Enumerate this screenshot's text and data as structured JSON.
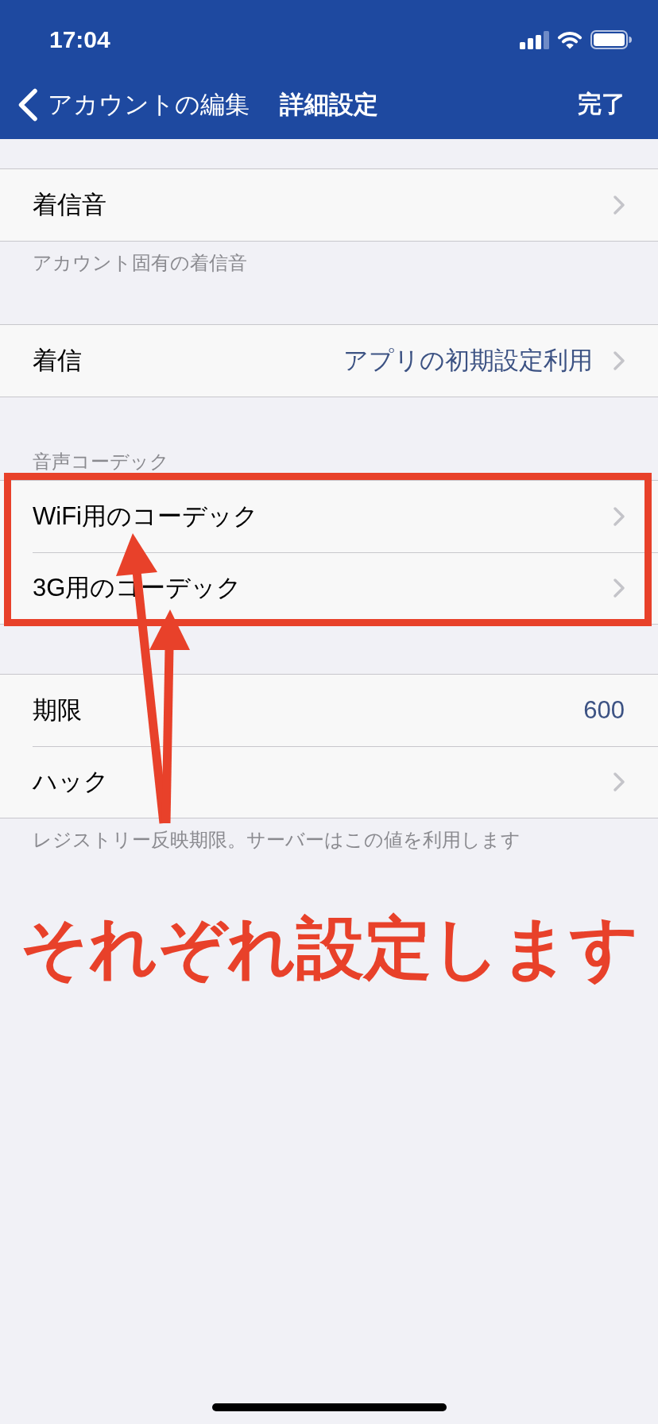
{
  "status_bar": {
    "time": "17:04"
  },
  "nav_bar": {
    "back_label": "アカウントの編集",
    "title": "詳細設定",
    "action": "完了"
  },
  "sections": [
    {
      "rows": [
        {
          "label": "着信音",
          "disclosure": true
        }
      ],
      "footer": "アカウント固有の着信音"
    },
    {
      "rows": [
        {
          "label": "着信",
          "value": "アプリの初期設定利用",
          "disclosure": true
        }
      ]
    },
    {
      "header": "音声コーデック",
      "rows": [
        {
          "label": "WiFi用のコーデック",
          "disclosure": true
        },
        {
          "label": "3G用のコーデック",
          "disclosure": true
        }
      ],
      "highlighted": true
    },
    {
      "rows": [
        {
          "label": "期限",
          "value": "600",
          "disclosure": false
        },
        {
          "label": "ハック",
          "disclosure": true
        }
      ],
      "footer": "レジストリー反映期限。サーバーはこの値を利用します"
    }
  ],
  "annotation": {
    "caption": "それぞれ設定します"
  }
}
